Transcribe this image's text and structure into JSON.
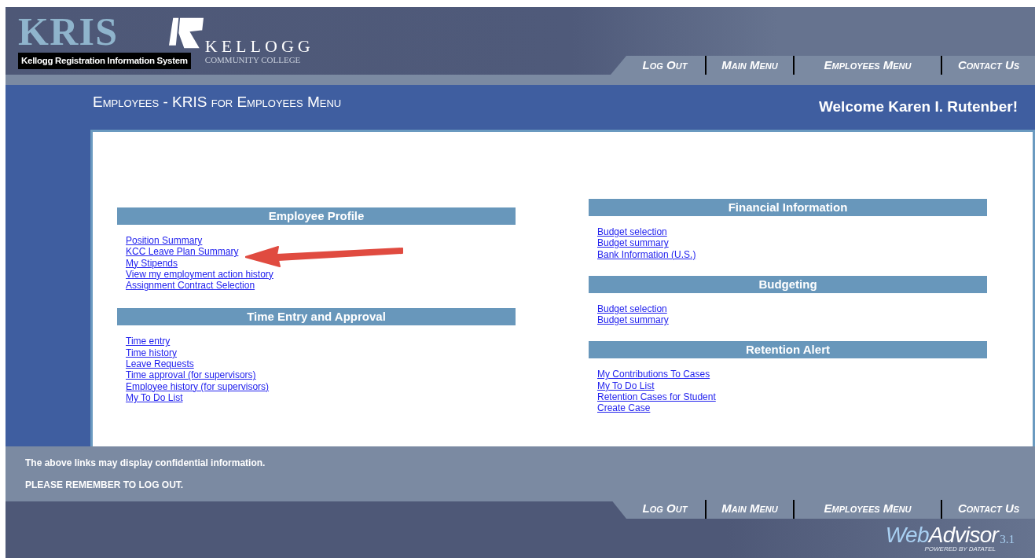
{
  "header": {
    "logo_title": "KRIS",
    "logo_subtitle": "Kellogg Registration Information System",
    "college_name": "KELLOGG",
    "college_subtitle": "COMMUNITY COLLEGE"
  },
  "top_nav": [
    "Log Out",
    "Main Menu",
    "Employees Menu",
    "Contact Us"
  ],
  "page_title": "Employees - KRIS for Employees Menu",
  "welcome": "Welcome Karen I. Rutenber!",
  "left_sections": [
    {
      "title": "Employee Profile",
      "links": [
        "Position Summary",
        "KCC Leave Plan Summary",
        "My Stipends",
        "View my employment action history",
        "Assignment Contract Selection"
      ]
    },
    {
      "title": "Time Entry and Approval",
      "links": [
        "Time entry",
        "Time history",
        "Leave Requests",
        "Time approval (for supervisors)",
        "Employee history (for supervisors)",
        "My To Do List"
      ]
    }
  ],
  "right_sections": [
    {
      "title": "Financial Information",
      "links": [
        "Budget selection",
        "Budget summary",
        "Bank Information (U.S.)"
      ]
    },
    {
      "title": "Budgeting",
      "links": [
        "Budget selection",
        "Budget summary"
      ]
    },
    {
      "title": "Retention Alert",
      "links": [
        "My Contributions To Cases",
        "My To Do List",
        "Retention Cases for Student",
        "Create Case"
      ]
    }
  ],
  "footer_notes": [
    "The above links may display confidential information.",
    "PLEASE REMEMBER TO LOG OUT."
  ],
  "bottom_nav": [
    "Log Out",
    "Main Menu",
    "Employees Menu",
    "Contact Us"
  ],
  "footer_logo": {
    "web": "Web",
    "advisor": "Advisor",
    "version": "3.1",
    "tagline": "POWERED BY DATATEL"
  }
}
